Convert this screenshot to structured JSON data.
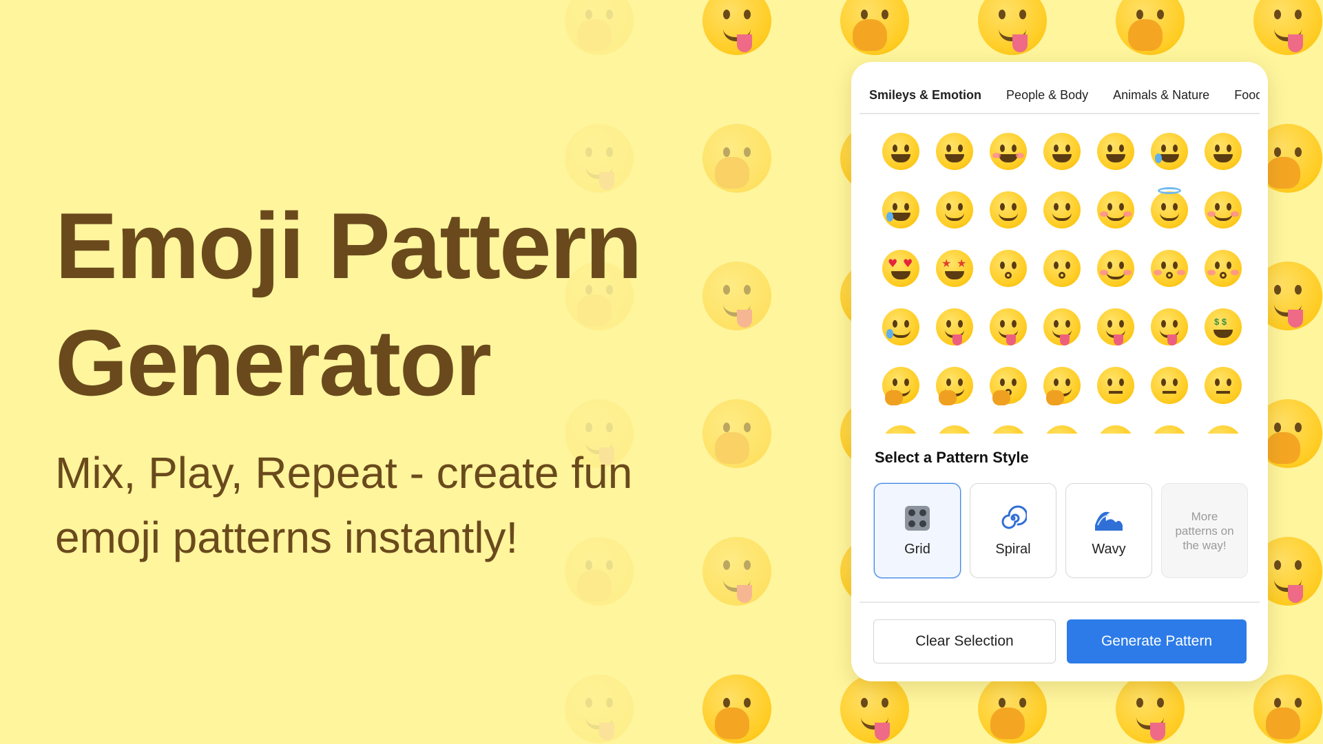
{
  "hero": {
    "title_line1": "Emoji Pattern",
    "title_line2": "Generator",
    "subtitle": "Mix, Play, Repeat - create fun emoji patterns instantly!"
  },
  "tabs": [
    {
      "label": "Smileys & Emotion",
      "active": true
    },
    {
      "label": "People & Body",
      "active": false
    },
    {
      "label": "Animals & Nature",
      "active": false
    },
    {
      "label": "Food",
      "active": false
    }
  ],
  "emoji_grid_icons": [
    [
      "grinning-face-icon",
      "grinning-face-big-eyes-icon",
      "grinning-smiling-eyes-icon",
      "beaming-face-icon",
      "squinting-laugh-icon",
      "grinning-sweat-icon",
      "rofl-icon"
    ],
    [
      "tears-of-joy-icon",
      "slightly-smiling-icon",
      "upside-down-face-icon",
      "winking-face-icon",
      "smiling-eyes-icon",
      "halo-face-icon",
      "smiling-hearts-icon"
    ],
    [
      "heart-eyes-icon",
      "star-struck-icon",
      "face-blowing-kiss-icon",
      "kissing-face-icon",
      "smiling-face-icon",
      "kissing-closed-eyes-icon",
      "kissing-smiling-eyes-icon"
    ],
    [
      "smiling-tear-icon",
      "yum-face-icon",
      "tongue-out-icon",
      "winking-tongue-icon",
      "zany-face-icon",
      "squinting-tongue-icon",
      "money-mouth-icon"
    ],
    [
      "hugging-face-icon",
      "hand-over-mouth-icon",
      "shushing-face-icon",
      "thinking-face-icon",
      "zipper-mouth-icon",
      "raised-eyebrow-icon",
      "neutral-face-icon"
    ],
    [
      "expressionless-icon",
      "no-mouth-icon",
      "smirk-icon",
      "unamused-icon",
      "rolling-eyes-icon",
      "grimacing-icon",
      "lying-face-icon"
    ]
  ],
  "pattern_section": {
    "title": "Select a Pattern Style",
    "styles": [
      {
        "label": "Grid",
        "icon": "grid-icon",
        "glyph": "🎛",
        "selected": true
      },
      {
        "label": "Spiral",
        "icon": "spiral-icon",
        "glyph": "🌀",
        "selected": false
      },
      {
        "label": "Wavy",
        "icon": "wave-icon",
        "glyph": "🌊",
        "selected": false
      },
      {
        "label": "More patterns on the way!",
        "icon": "",
        "glyph": "",
        "disabled": true
      }
    ]
  },
  "actions": {
    "clear": "Clear Selection",
    "generate": "Generate Pattern"
  },
  "colors": {
    "background": "#fef59d",
    "title_text": "#6a4a1c",
    "primary_button": "#2c7be8",
    "selected_border": "#3d84e6"
  }
}
